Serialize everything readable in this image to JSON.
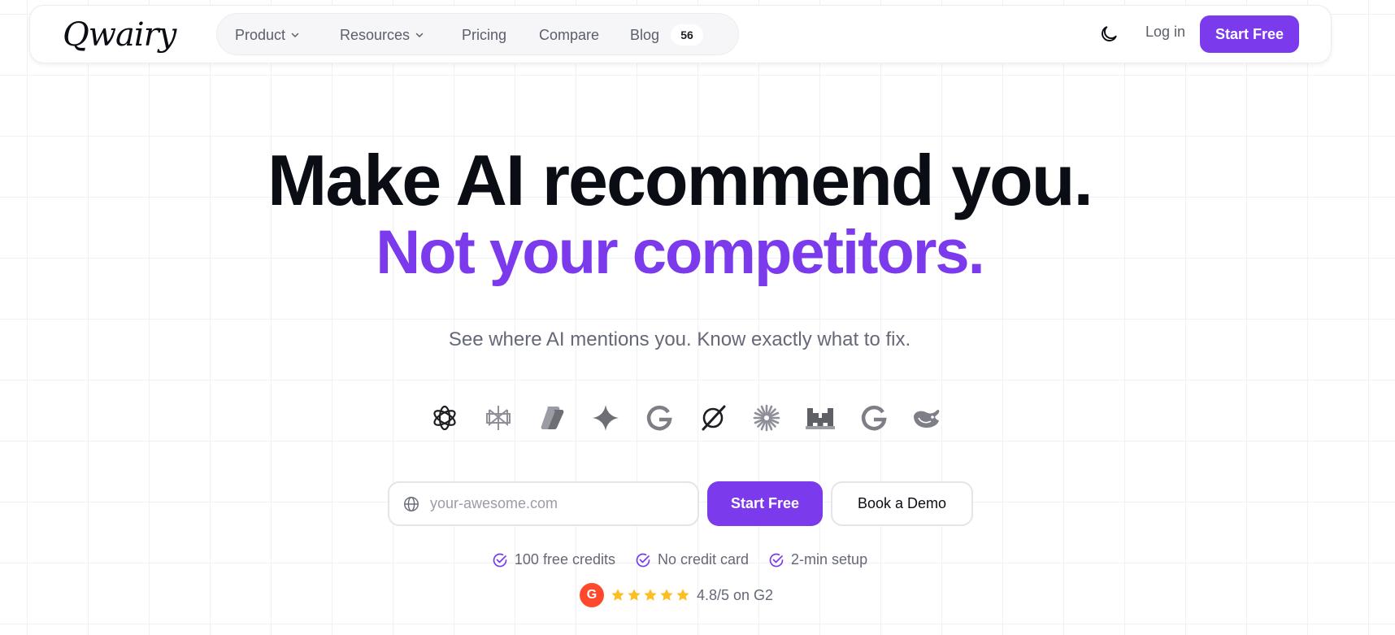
{
  "header": {
    "logo_text": "Qwairy",
    "nav": [
      {
        "label": "Product",
        "has_dropdown": true
      },
      {
        "label": "Resources",
        "has_dropdown": true
      },
      {
        "label": "Pricing",
        "has_dropdown": false
      },
      {
        "label": "Compare",
        "has_dropdown": false
      },
      {
        "label": "Blog",
        "has_dropdown": false,
        "badge": "56"
      }
    ],
    "theme_icon": "moon-icon",
    "login_label": "Log in",
    "cta_label": "Start Free"
  },
  "hero": {
    "headline": "Make AI recommend you.",
    "headline_accent": "Not your competitors.",
    "subheadline": "See where AI mentions you. Know exactly what to fix."
  },
  "ai_logos": [
    "openai-icon",
    "perplexity-icon",
    "copilot-icon",
    "gemini-icon",
    "google-icon",
    "grok-icon",
    "claude-icon",
    "mistral-icon",
    "google-ai-mode-icon",
    "deepseek-icon"
  ],
  "form": {
    "input_placeholder": "your-awesome.com",
    "input_value": "",
    "primary_label": "Start Free",
    "secondary_label": "Book a Demo"
  },
  "perks": [
    "100 free credits",
    "No credit card",
    "2-min setup"
  ],
  "rating": {
    "badge": "G",
    "stars": 5,
    "text": "4.8/5 on G2"
  },
  "colors": {
    "accent": "#7c3aed",
    "text_dark": "#0b0d14",
    "text_muted": "#656877",
    "star": "#fbbf24",
    "g2": "#ff492c"
  }
}
